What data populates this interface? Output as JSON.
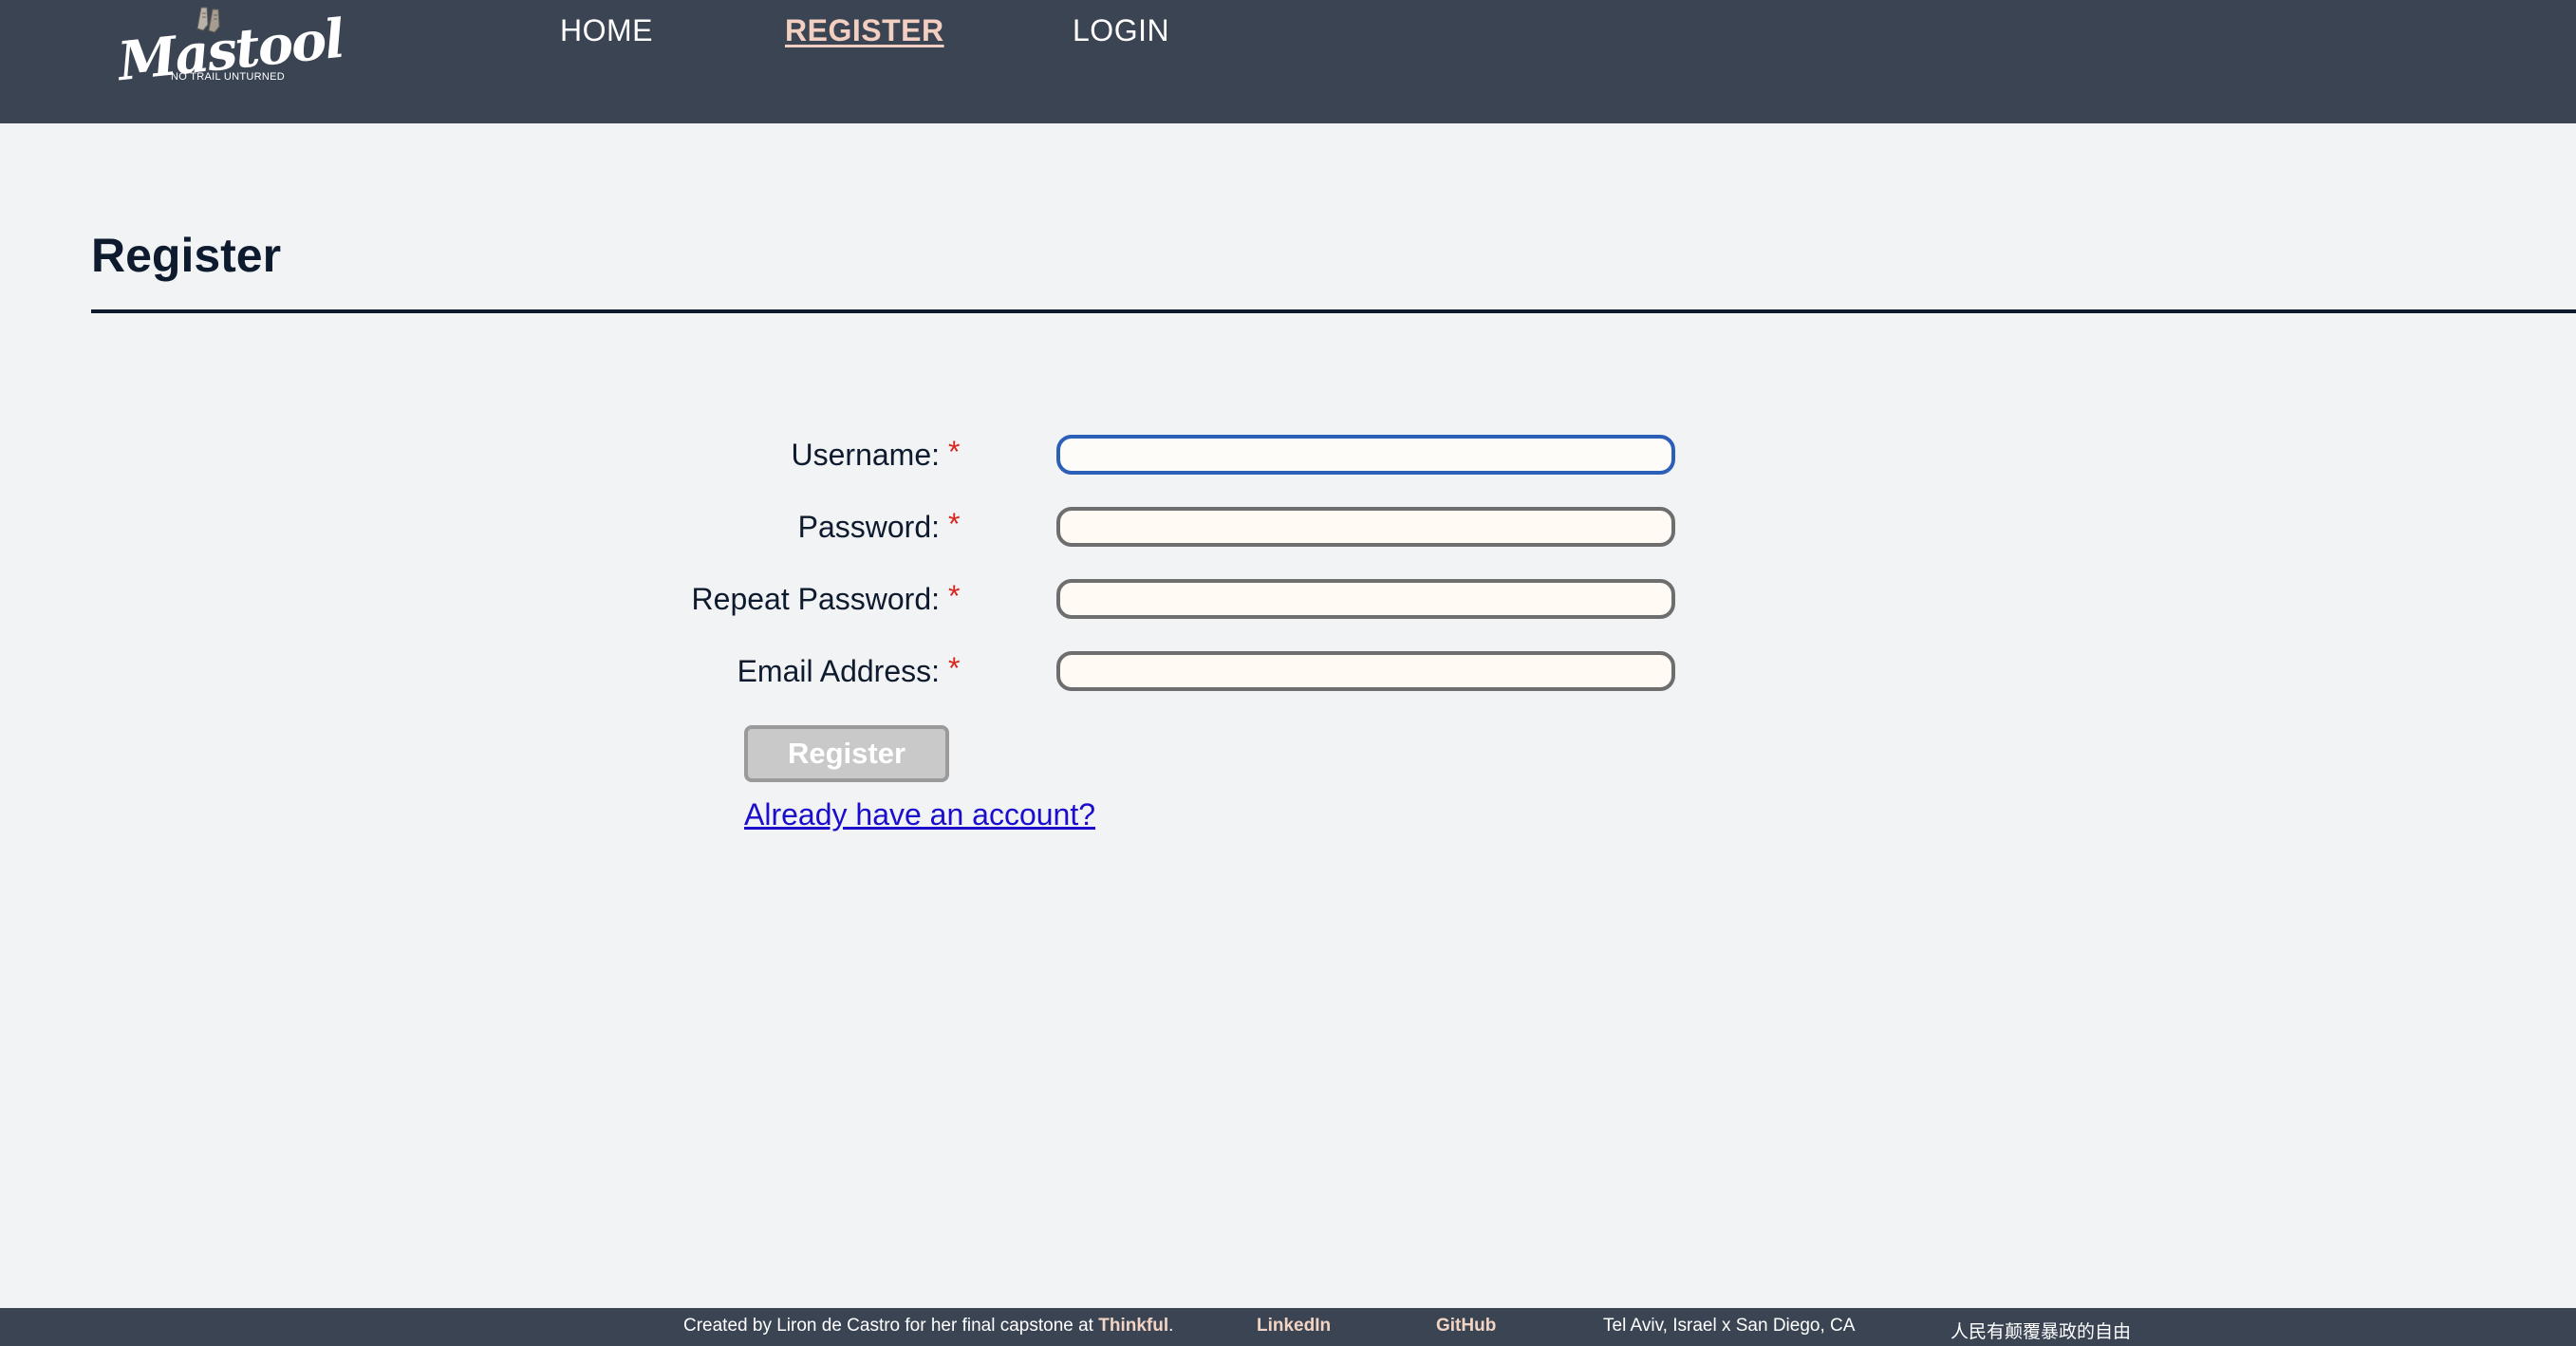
{
  "header": {
    "logo": {
      "script": "Mastool",
      "tagline": "NO TRAIL UNTURNED"
    },
    "nav": [
      {
        "label": "HOME",
        "active": false
      },
      {
        "label": "REGISTER",
        "active": true
      },
      {
        "label": "LOGIN",
        "active": false
      }
    ]
  },
  "main": {
    "title": "Register",
    "form": {
      "fields": [
        {
          "label": "Username:",
          "required_mark": "*",
          "value": "",
          "focused": true
        },
        {
          "label": "Password:",
          "required_mark": "*",
          "value": ""
        },
        {
          "label": "Repeat Password:",
          "required_mark": "*",
          "value": ""
        },
        {
          "label": "Email Address:",
          "required_mark": "*",
          "value": ""
        }
      ],
      "submit_label": "Register",
      "login_link": "Already have an account?"
    }
  },
  "footer": {
    "credit_prefix": "Created by Liron de Castro for her final capstone at ",
    "credit_org": "Thinkful",
    "credit_suffix": ".",
    "linkedin": "LinkedIn",
    "github": "GitHub",
    "location": "Tel Aviv, Israel x San Diego, CA",
    "slogan": "人民有颠覆暴政的自由"
  },
  "colors": {
    "header_bg": "#3a4453",
    "active_nav": "#f2cfc0",
    "required": "#d6281f",
    "link": "#1a0dcc",
    "focus_border": "#2b5fb8"
  }
}
